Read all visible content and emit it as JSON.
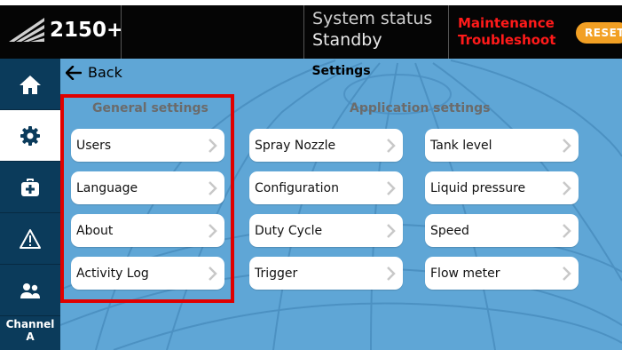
{
  "header": {
    "model": "2150+",
    "status_label": "System status",
    "status_value": "Standby",
    "alert_line1": "Maintenance",
    "alert_line2": "Troubleshoot",
    "reset_label": "RESET"
  },
  "nav": {
    "items": [
      {
        "name": "home",
        "icon": "home-icon"
      },
      {
        "name": "settings",
        "icon": "gear-icon",
        "active": true
      },
      {
        "name": "toolbox",
        "icon": "toolbox-icon"
      },
      {
        "name": "alarms",
        "icon": "warning-icon"
      },
      {
        "name": "users",
        "icon": "users-icon"
      }
    ],
    "channel_line1": "Channel",
    "channel_line2": "A"
  },
  "main": {
    "back_label": "Back",
    "title": "Settings",
    "general": {
      "title": "General settings",
      "items": [
        "Users",
        "Language",
        "About",
        "Activity Log"
      ]
    },
    "application": {
      "title": "Application settings",
      "col1": [
        "Spray Nozzle",
        "Configuration",
        "Duty Cycle",
        "Trigger"
      ],
      "col2": [
        "Tank level",
        "Liquid pressure",
        "Speed",
        "Flow meter"
      ]
    }
  },
  "colors": {
    "background": "#5fa6d6",
    "nav": "#0b3b5b",
    "highlight": "#e00000",
    "alert": "#ff1a1a",
    "reset": "#f2a024"
  }
}
